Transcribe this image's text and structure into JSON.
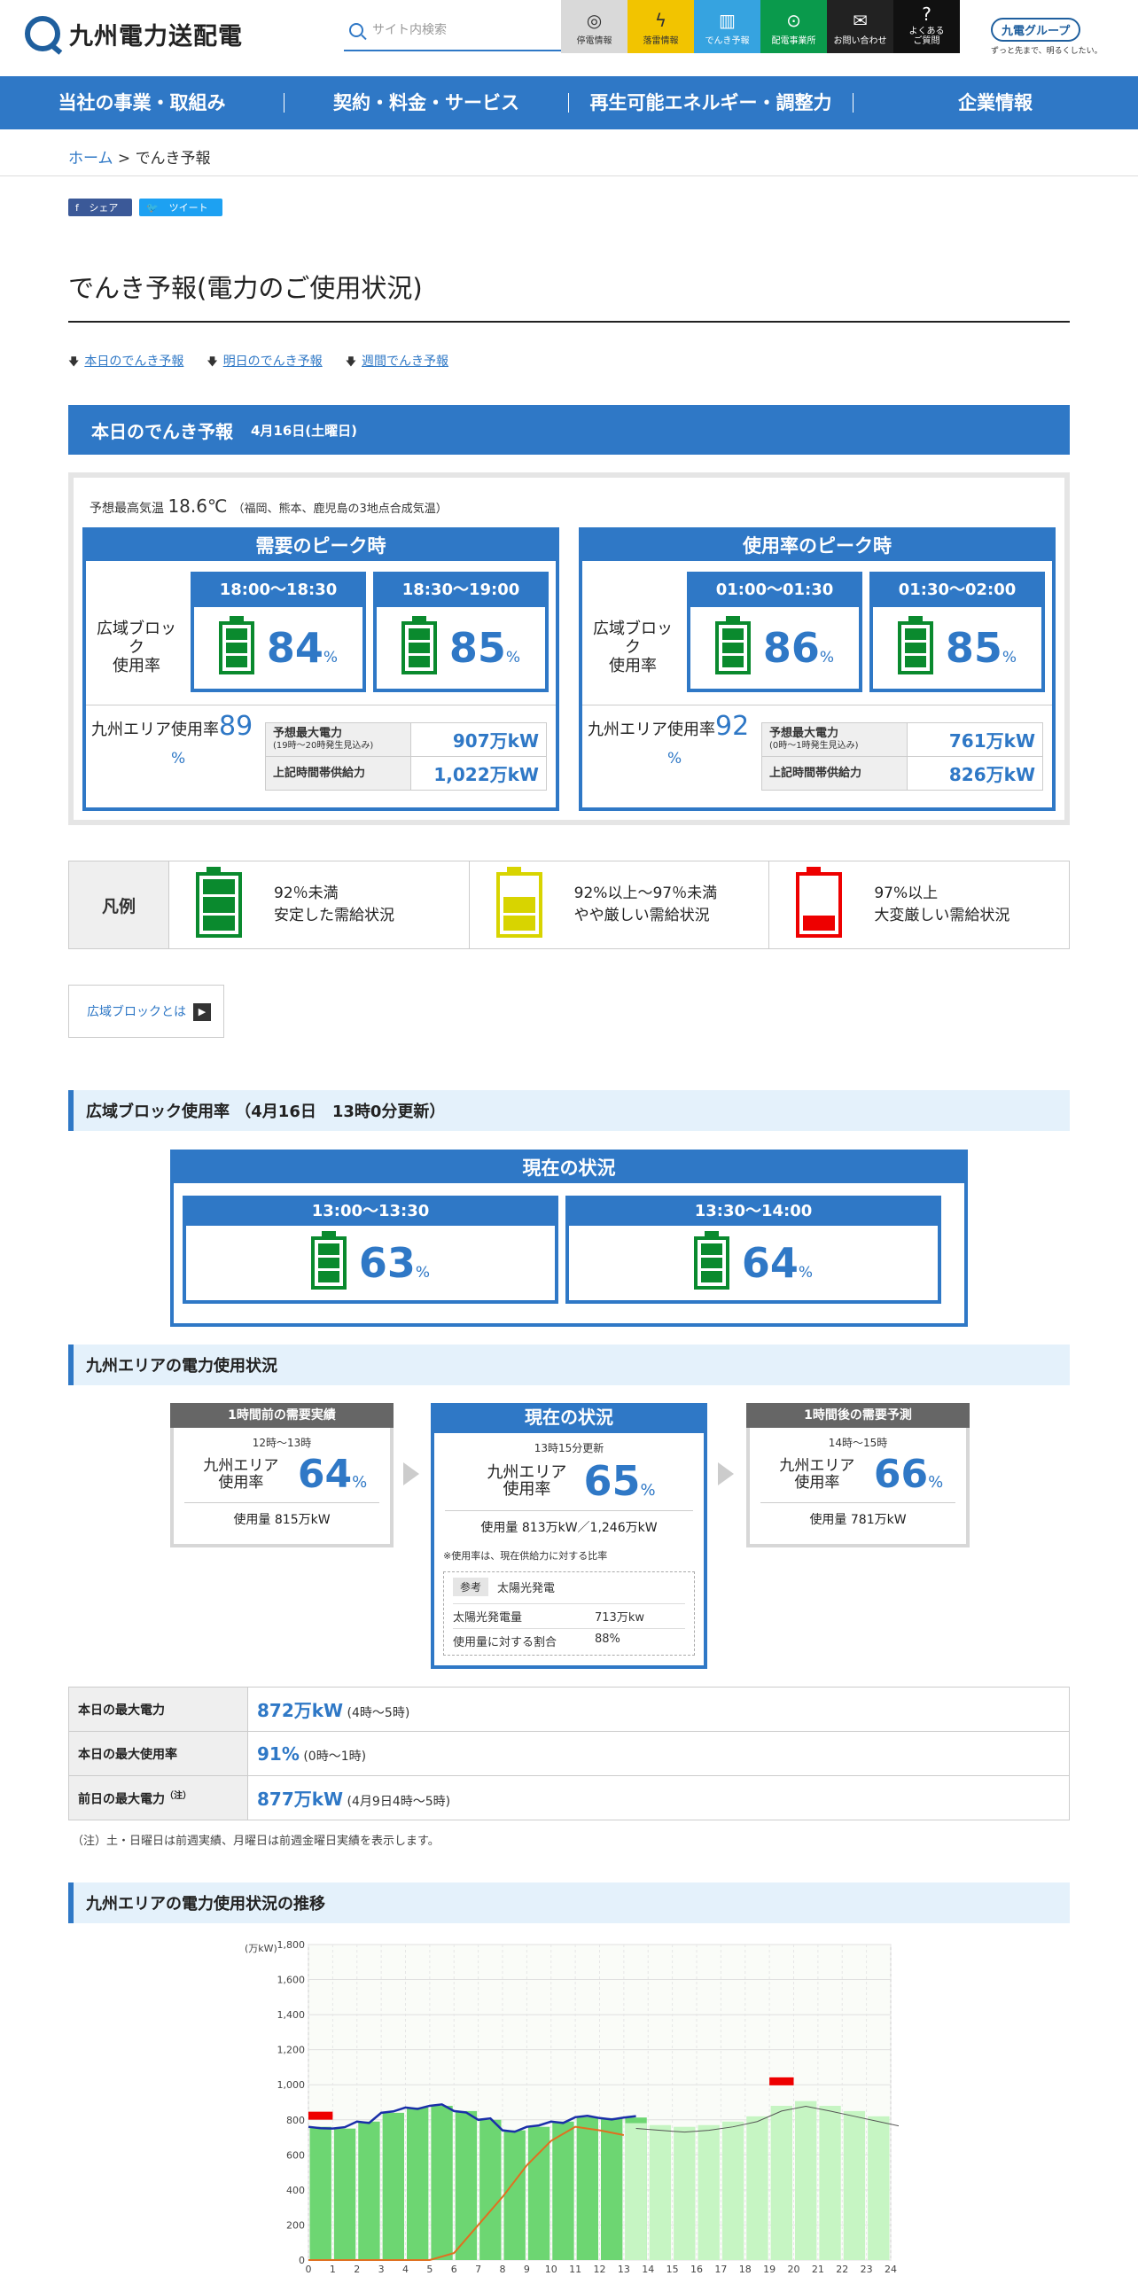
{
  "header": {
    "logo_text": "九州電力送配電",
    "search_placeholder": "サイト内検索",
    "quick_links": [
      {
        "label": "停電情報",
        "icon": "bulb-icon"
      },
      {
        "label": "落雷情報",
        "icon": "lightning-icon"
      },
      {
        "label": "でんき予報",
        "icon": "meter-icon"
      },
      {
        "label": "配電事業所",
        "icon": "pin-icon"
      },
      {
        "label": "お問い合わせ",
        "icon": "mail-icon"
      },
      {
        "label": "よくある\nご質問",
        "icon": "question-icon"
      }
    ],
    "group_logo": "九電グループ",
    "group_tagline": "ずっと先まで、明るくしたい。"
  },
  "nav": {
    "items": [
      "当社の事業・取組み",
      "契約・料金・サービス",
      "再生可能エネルギー・調整力",
      "企業情報"
    ]
  },
  "breadcrumb": {
    "home": "ホーム",
    "sep": " > ",
    "current": "でんき予報"
  },
  "share": {
    "facebook": "シェア",
    "twitter": "ツイート"
  },
  "page_title": "でんき予報(電力のご使用状況)",
  "anchors": [
    "本日のでんき予報",
    "明日のでんき予報",
    "週間でんき予報"
  ],
  "today": {
    "title": "本日のでんき予報",
    "date": "4月16日(土曜日)",
    "temp_label": "予想最高気温",
    "temp_value": "18.6℃",
    "temp_note": "（福岡、熊本、鹿児島の3地点合成気温）",
    "demand_peak": {
      "title": "需要のピーク時",
      "block_label": "広域ブロック\n使用率",
      "slots": [
        {
          "time": "18:00～18:30",
          "pct": "84"
        },
        {
          "time": "18:30～19:00",
          "pct": "85"
        }
      ],
      "area_label": "九州エリア使用率",
      "area_pct": "89",
      "max_power_label": "予想最大電力",
      "max_power_note": "(19時～20時発生見込み)",
      "max_power_value": "907万kW",
      "supply_label": "上記時間帯供給力",
      "supply_value": "1,022万kW"
    },
    "rate_peak": {
      "title": "使用率のピーク時",
      "block_label": "広域ブロック\n使用率",
      "slots": [
        {
          "time": "01:00～01:30",
          "pct": "86"
        },
        {
          "time": "01:30～02:00",
          "pct": "85"
        }
      ],
      "area_label": "九州エリア使用率",
      "area_pct": "92",
      "max_power_label": "予想最大電力",
      "max_power_note": "(0時～1時発生見込み)",
      "max_power_value": "761万kW",
      "supply_label": "上記時間帯供給力",
      "supply_value": "826万kW"
    },
    "pct_unit": "%"
  },
  "legend": {
    "title": "凡例",
    "items": [
      {
        "line1": "92％未満",
        "line2": "安定した需給状況",
        "level": "green"
      },
      {
        "line1": "92%以上～97％未満",
        "line2": "やや厳しい需給状況",
        "level": "yellow"
      },
      {
        "line1": "97%以上",
        "line2": "大変厳しい需給状況",
        "level": "red"
      }
    ]
  },
  "about_link": "広域ブロックとは",
  "block_section": {
    "title": "広域ブロック使用率 （4月16日　13時0分更新）",
    "now_title": "現在の状況",
    "slots": [
      {
        "time": "13:00～13:30",
        "pct": "63"
      },
      {
        "time": "13:30～14:00",
        "pct": "64"
      }
    ]
  },
  "area_section": {
    "title": "九州エリアの電力使用状況",
    "prev": {
      "head": "1時間前の需要実績",
      "time": "12時～13時",
      "label": "九州エリア\n使用率",
      "pct": "64",
      "usage": "使用量 815万kW"
    },
    "now": {
      "head": "現在の状況",
      "time": "13時15分更新",
      "label": "九州エリア\n使用率",
      "pct": "65",
      "usage": "使用量 813万kW／1,246万kW",
      "note": "※使用率は、現在供給力に対する比率",
      "ref_tag": "参考",
      "ref_title": "太陽光発電",
      "solar_label": "太陽光発電量",
      "solar_value": "713万kw",
      "ratio_label": "使用量に対する割合",
      "ratio_value": "88%"
    },
    "next": {
      "head": "1時間後の需要予測",
      "time": "14時～15時",
      "label": "九州エリア\n使用率",
      "pct": "66",
      "usage": "使用量 781万kW"
    }
  },
  "summary": [
    {
      "label": "本日の最大電力",
      "value": "872万kW",
      "note": " (4時～5時)"
    },
    {
      "label": "本日の最大使用率",
      "value": "91%",
      "note": " (0時～1時)"
    },
    {
      "label": "前日の最大電力",
      "label_sup": "（注）",
      "value": "877万kW",
      "note": " (4月9日4時～5時)"
    }
  ],
  "footnote": "（注）土・日曜日は前週実績、月曜日は前週金曜日実績を表示します。",
  "trend_section": {
    "title": "九州エリアの電力使用状況の推移"
  },
  "colors": {
    "accent": "#2f78c6",
    "green": "#0a8a2e",
    "yellow": "#d8d400",
    "red": "#e00000"
  },
  "chart_data": {
    "type": "bar",
    "ylabel": "(万kW)",
    "ylim": [
      0,
      1800
    ],
    "yticks": [
      "0",
      "200",
      "400",
      "600",
      "800",
      "1,000",
      "1,200",
      "1,400",
      "1,600",
      "1,800"
    ],
    "x": [
      "0",
      "1",
      "2",
      "3",
      "4",
      "5",
      "6",
      "7",
      "8",
      "9",
      "10",
      "11",
      "12",
      "13",
      "14",
      "15",
      "16",
      "17",
      "18",
      "19",
      "20",
      "21",
      "22",
      "23",
      "24"
    ],
    "series": [
      {
        "kind": "actual",
        "values": [
          760,
          750,
          790,
          840,
          870,
          880,
          850,
          800,
          740,
          760,
          790,
          815,
          810,
          813
        ]
      },
      {
        "kind": "forecast",
        "values": [
          781,
          770,
          760,
          770,
          790,
          820,
          880,
          907,
          880,
          850,
          820,
          790
        ]
      },
      {
        "kind": "solar",
        "values": [
          0,
          0,
          0,
          0,
          0,
          0,
          40,
          200,
          360,
          540,
          680,
          760,
          740,
          713
        ]
      }
    ],
    "peak_markers": [
      {
        "hour": 0,
        "value": 826
      },
      {
        "hour": 19,
        "value": 1022
      }
    ]
  }
}
